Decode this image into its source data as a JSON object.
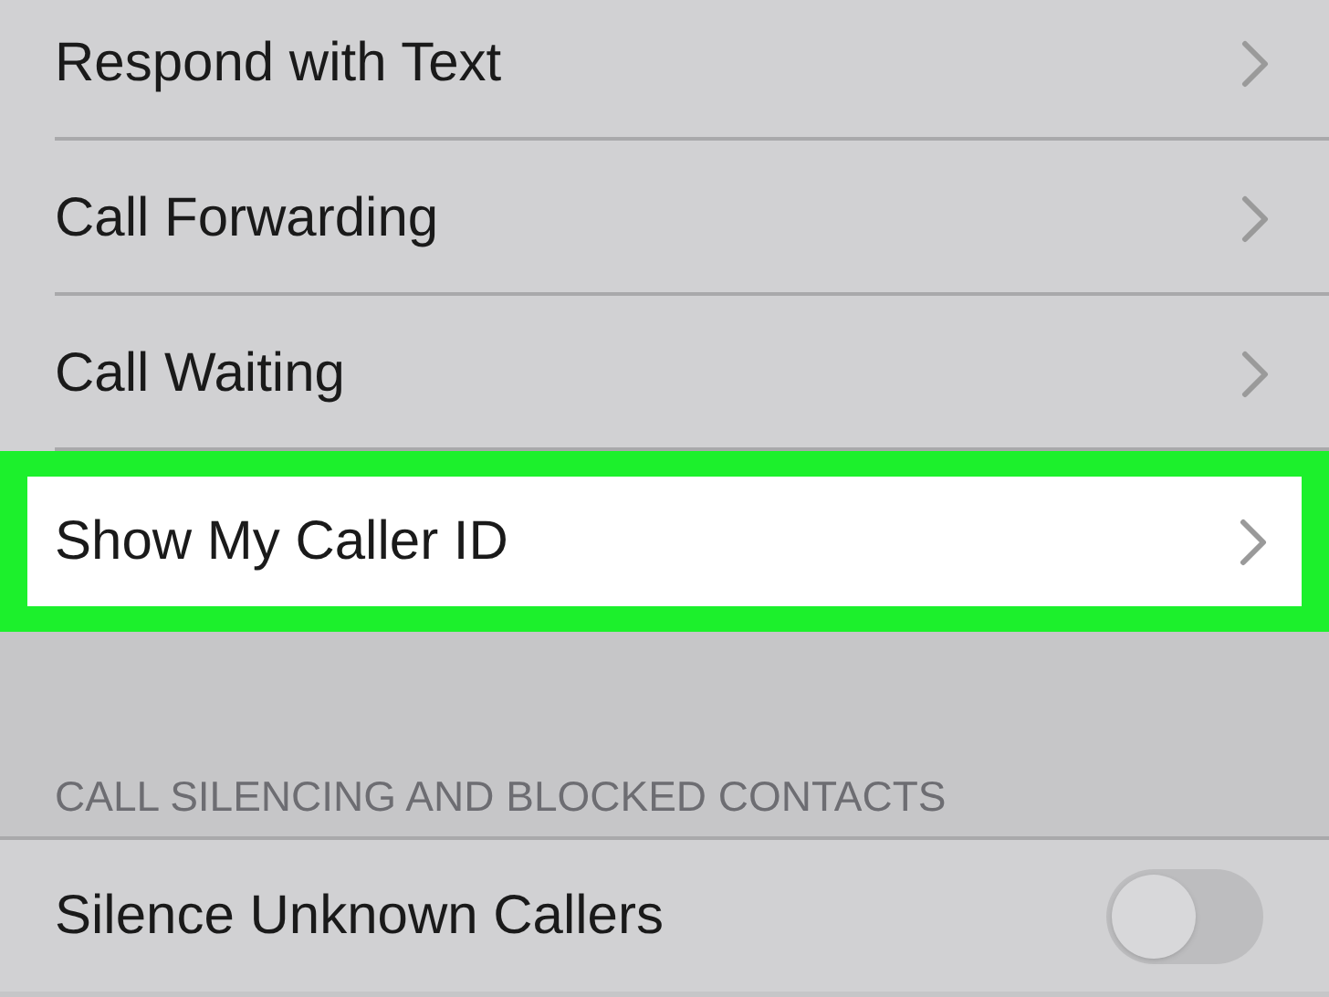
{
  "rows": [
    {
      "label": "Respond with Text",
      "highlighted": false
    },
    {
      "label": "Call Forwarding",
      "highlighted": false
    },
    {
      "label": "Call Waiting",
      "highlighted": false
    },
    {
      "label": "Show My Caller ID",
      "highlighted": true
    }
  ],
  "section": {
    "header": "CALL SILENCING AND BLOCKED CONTACTS",
    "rows": [
      {
        "kind": "toggle",
        "label": "Silence Unknown Callers",
        "on": false
      }
    ]
  }
}
